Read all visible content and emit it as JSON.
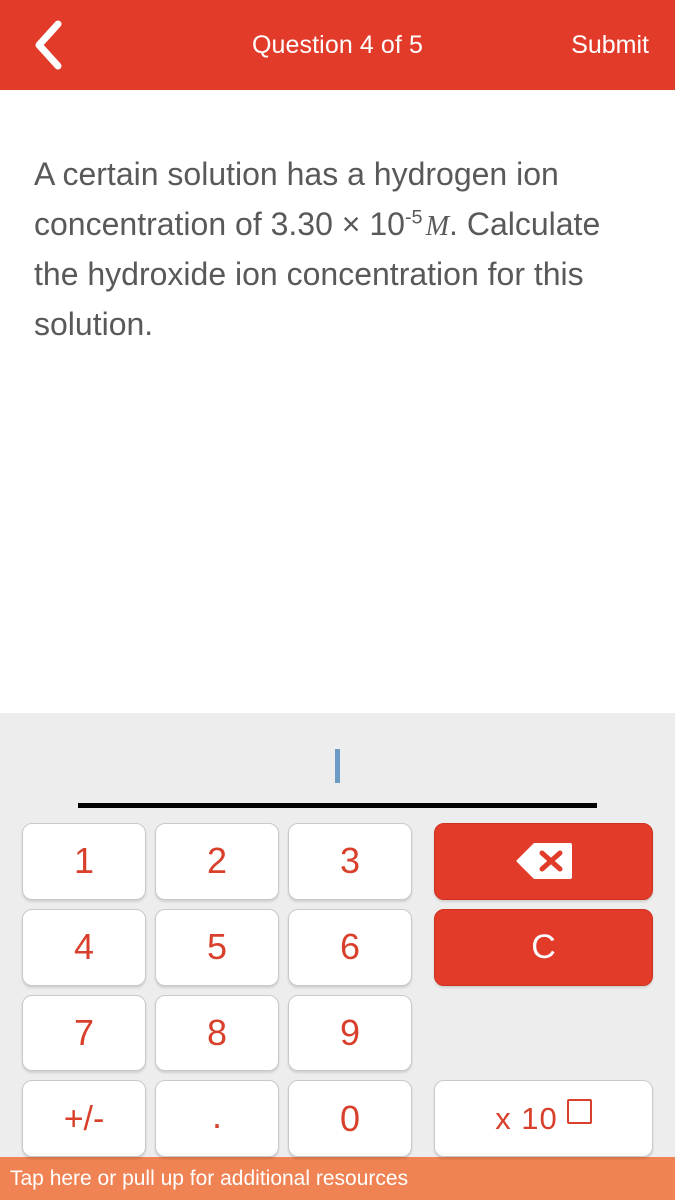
{
  "header": {
    "back_icon": "chevron-left-icon",
    "title": "Question 4 of 5",
    "submit_label": "Submit",
    "bg_color": "#e23b2a",
    "text_color": "#ffffff"
  },
  "question": {
    "line1": "A certain solution has a hydrogen",
    "line2_prefix": "ion concentration of 3.30 × 10",
    "exponent": "-5",
    "unit": "M",
    "unit_suffix": ".",
    "line3": "Calculate the hydroxide ion",
    "line4": "concentration for this solution.",
    "text_color": "#58595b"
  },
  "answer": {
    "value": "",
    "caret_visible": true,
    "caret_color": "#6c9bc6",
    "underline_color": "#000000"
  },
  "keypad": {
    "bg_color": "#ededed",
    "key_text_color": "#d8402c",
    "accent_color": "#e23b2a",
    "numbers": [
      {
        "name": "key-1",
        "label": "1"
      },
      {
        "name": "key-2",
        "label": "2"
      },
      {
        "name": "key-3",
        "label": "3"
      },
      {
        "name": "key-4",
        "label": "4"
      },
      {
        "name": "key-5",
        "label": "5"
      },
      {
        "name": "key-6",
        "label": "6"
      },
      {
        "name": "key-7",
        "label": "7"
      },
      {
        "name": "key-8",
        "label": "8"
      },
      {
        "name": "key-9",
        "label": "9"
      },
      {
        "name": "key-plus-minus",
        "label": "+/-"
      },
      {
        "name": "key-decimal",
        "label": "."
      },
      {
        "name": "key-0",
        "label": "0"
      }
    ],
    "backspace": {
      "name": "backspace-icon",
      "label": ""
    },
    "clear": {
      "name": "clear-key",
      "label": "C"
    },
    "exponent": {
      "name": "times-ten-power-key",
      "label": "x 10",
      "box": "□"
    }
  },
  "resource_bar": {
    "label": "Tap here or pull up for additional resources",
    "bg_color": "#ef8354",
    "text_color": "#ffffff"
  }
}
